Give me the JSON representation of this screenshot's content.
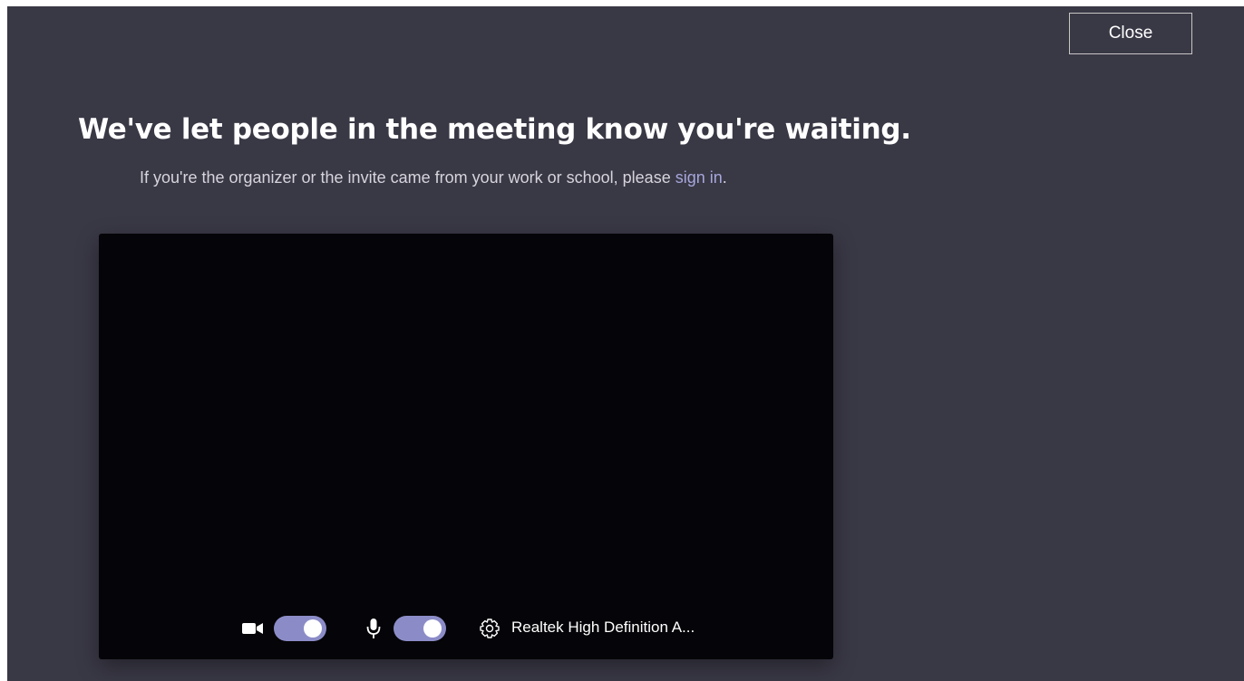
{
  "header": {
    "close_label": "Close"
  },
  "main": {
    "title": "We've let people in the meeting know you're waiting.",
    "subtitle_prefix": "If you're the organizer or the invite came from your work or school, please ",
    "sign_in_label": "sign in",
    "subtitle_suffix": "."
  },
  "preview": {
    "camera_icon": "video-camera-icon",
    "camera_on": true,
    "mic_icon": "microphone-icon",
    "mic_on": true,
    "settings_icon": "gear-icon",
    "audio_device_label": "Realtek High Definition A..."
  },
  "colors": {
    "background": "#393845",
    "preview_background": "#050408",
    "toggle_on": "#8b8cc7",
    "link": "#a6a7dc"
  }
}
